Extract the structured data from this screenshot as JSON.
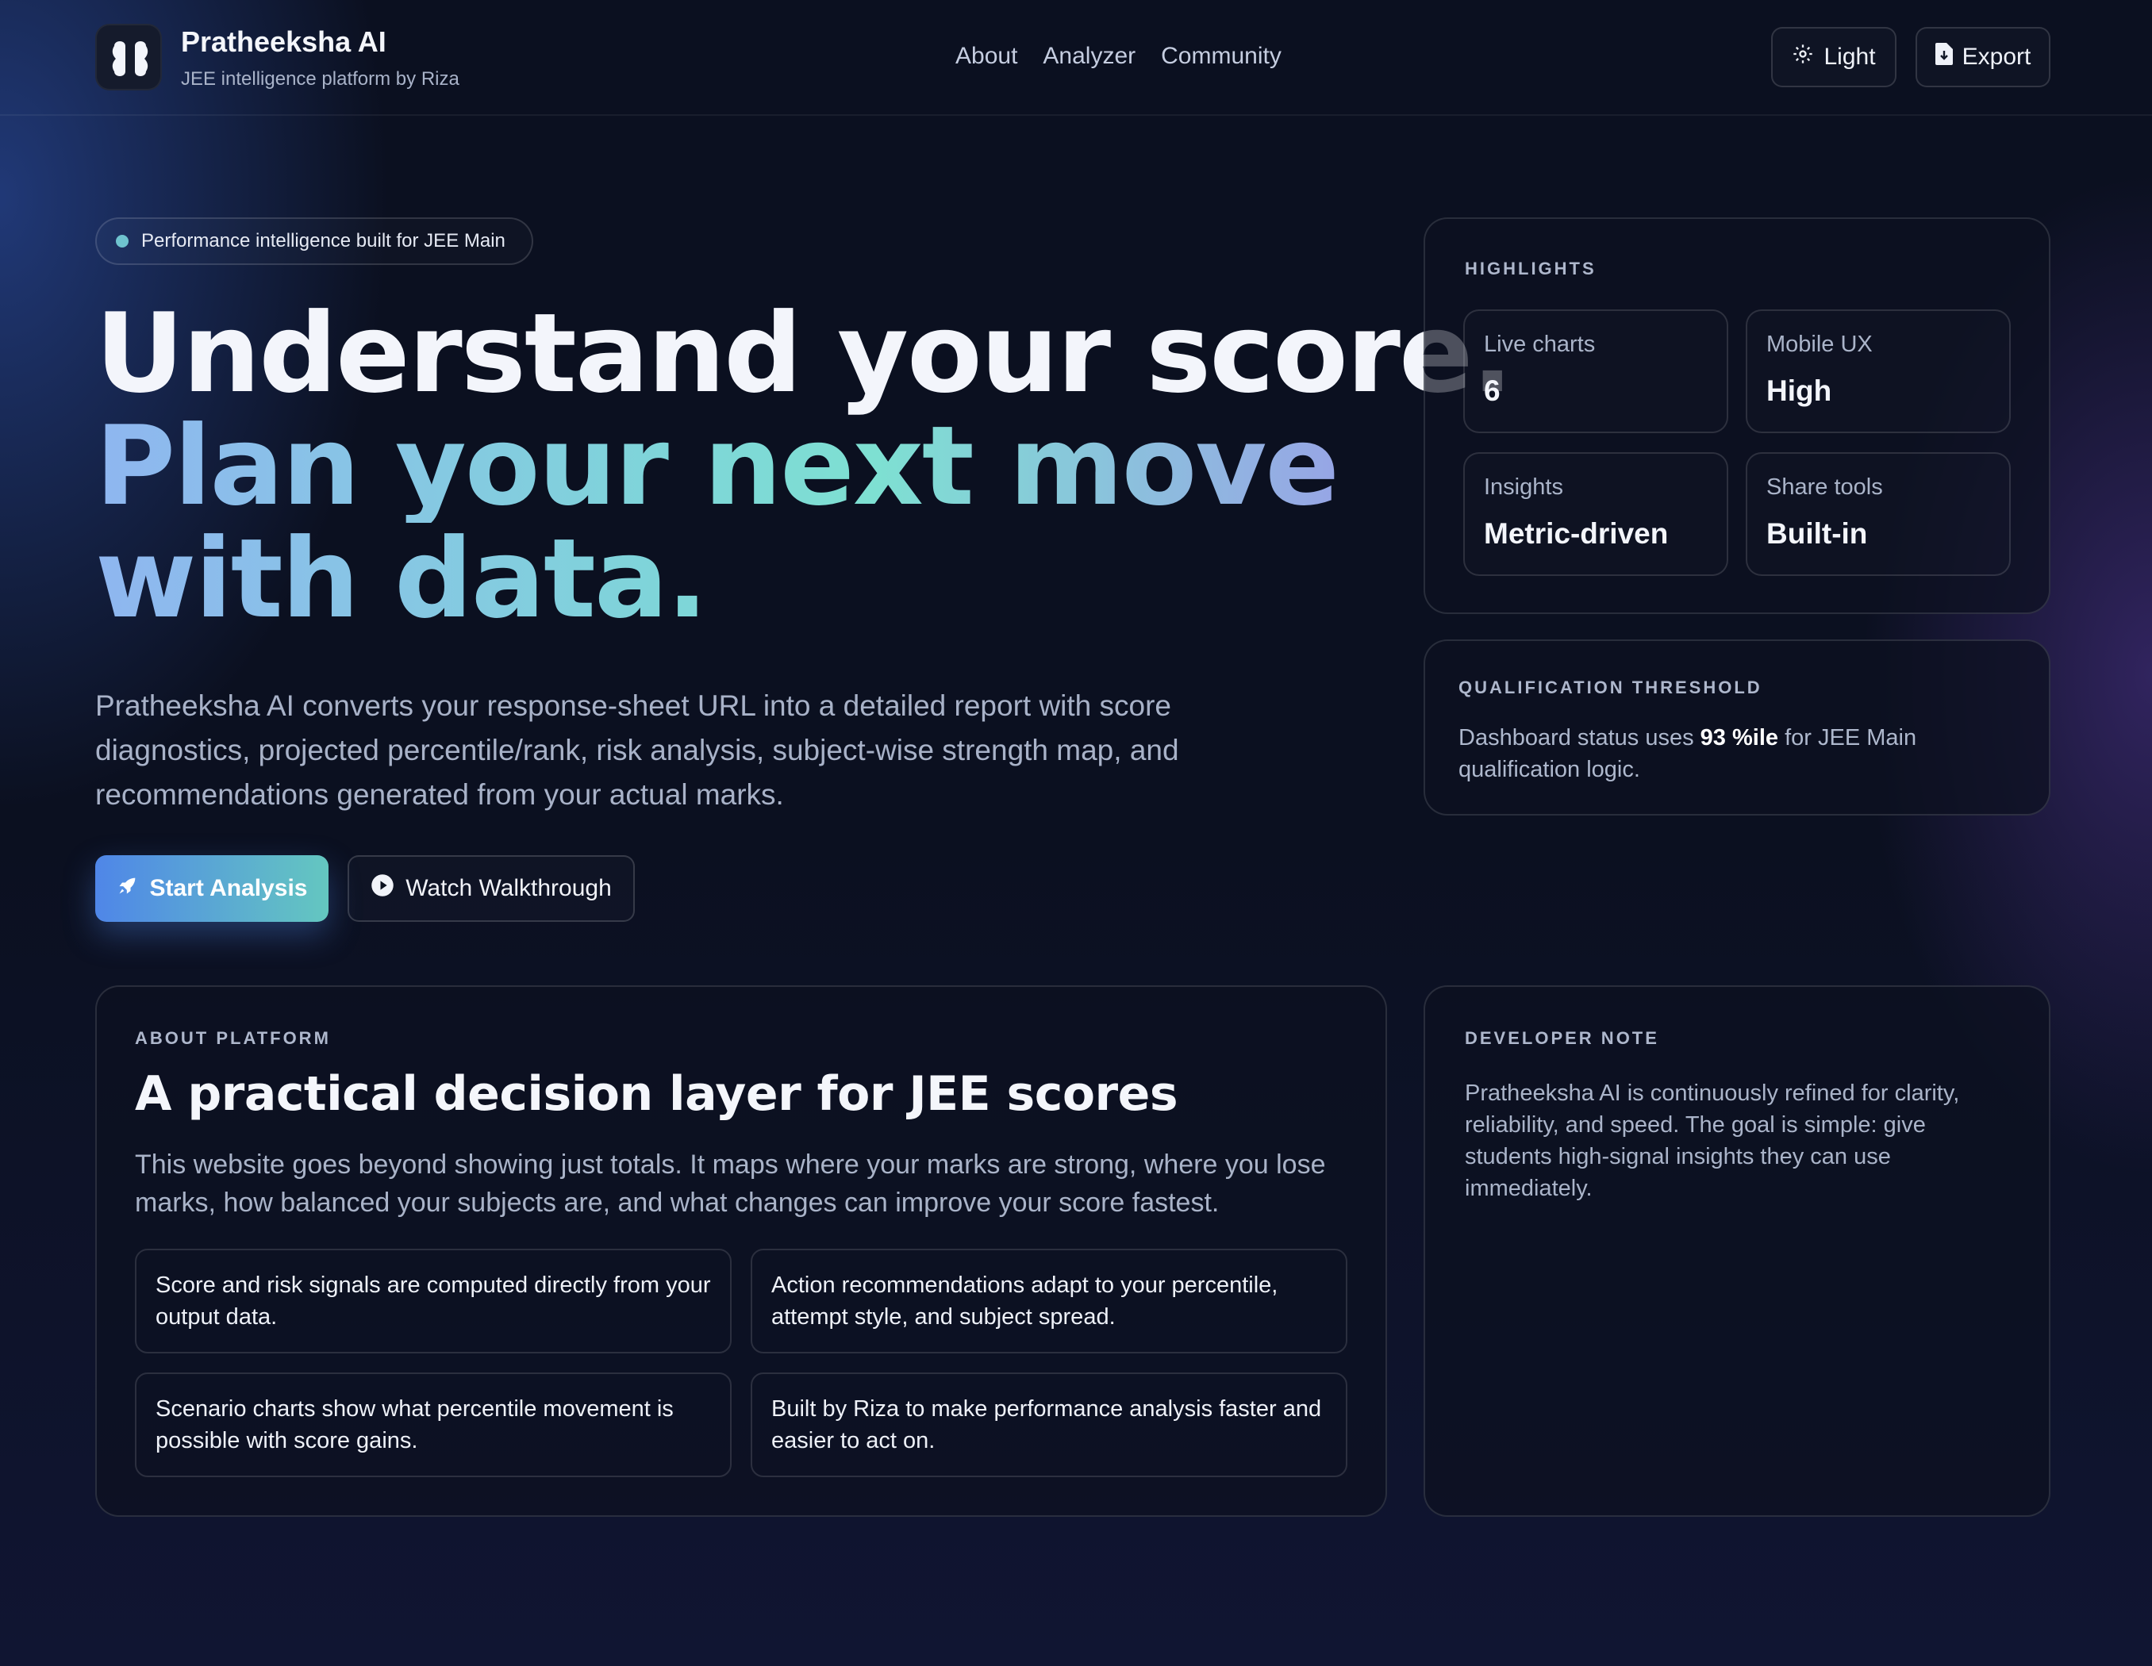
{
  "header": {
    "brand_name": "Pratheeksha AI",
    "brand_sub": "JEE intelligence platform by Riza",
    "nav": [
      "About",
      "Analyzer",
      "Community"
    ],
    "light_label": "Light",
    "export_label": "Export"
  },
  "hero": {
    "pill": "Performance intelligence built for JEE Main",
    "title_line1": "Understand your score.",
    "title_line2": "Plan your next move",
    "title_line3": "with data.",
    "description": "Pratheeksha AI converts your response-sheet URL into a detailed report with score diagnostics, projected percentile/rank, risk analysis, subject-wise strength map, and recommendations generated from your actual marks.",
    "start_label": "Start Analysis",
    "watch_label": "Watch Walkthrough"
  },
  "highlights": {
    "eyebrow": "HIGHLIGHTS",
    "tiles": [
      {
        "label": "Live charts",
        "value": "6"
      },
      {
        "label": "Mobile UX",
        "value": "High"
      },
      {
        "label": "Insights",
        "value": "Metric-driven"
      },
      {
        "label": "Share tools",
        "value": "Built-in"
      }
    ]
  },
  "threshold": {
    "eyebrow": "QUALIFICATION THRESHOLD",
    "text_before": "Dashboard status uses ",
    "value": "93 %ile",
    "text_after": " for JEE Main qualification logic."
  },
  "about": {
    "eyebrow": "ABOUT PLATFORM",
    "title": "A practical decision layer for JEE scores",
    "description": "This website goes beyond showing just totals. It maps where your marks are strong, where you lose marks, how balanced your subjects are, and what changes can improve your score fastest.",
    "features": [
      "Score and risk signals are computed directly from your output data.",
      "Action recommendations adapt to your percentile, attempt style, and subject spread.",
      "Scenario charts show what percentile movement is possible with score gains.",
      "Built by Riza to make performance analysis faster and easier to act on."
    ]
  },
  "developer_note": {
    "eyebrow": "DEVELOPER NOTE",
    "text": "Pratheeksha AI is continuously refined for clarity, reliability, and speed. The goal is simple: give students high-signal insights they can use immediately."
  },
  "icons": {
    "logo": "brain-logo-icon",
    "light": "gear-icon",
    "export": "file-export-icon",
    "start": "rocket-icon",
    "watch": "play-circle-icon"
  },
  "colors": {
    "accent_blue": "#4f86e8",
    "accent_teal": "#64c7c0",
    "background": "#0b1020"
  }
}
